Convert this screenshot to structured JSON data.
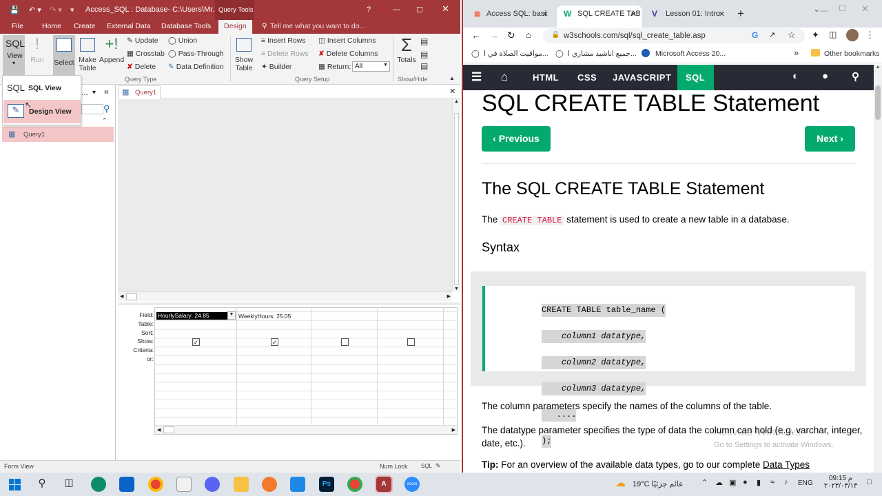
{
  "access": {
    "title": "Access_SQL : Database- C:\\Users\\Mr.Ya...",
    "query_tools": "Query Tools",
    "window_help": "?",
    "tabs": [
      "File",
      "Home",
      "Create",
      "External Data",
      "Database Tools",
      "Design"
    ],
    "tell_me": "Tell me what you want to do...",
    "ribbon": {
      "view": "View",
      "view_sql_glyph": "SQL",
      "run": "Run",
      "select": "Select",
      "make_table": "Make\nTable",
      "append": "Append",
      "update": "Update",
      "crosstab": "Crosstab",
      "delete": "Delete",
      "union": "Union",
      "pass_through": "Pass-Through",
      "data_definition": "Data Definition",
      "show_table": "Show\nTable",
      "insert_rows": "Insert Rows",
      "delete_rows": "Delete Rows",
      "builder": "Builder",
      "insert_columns": "Insert Columns",
      "delete_columns": "Delete Columns",
      "return_label": "Return:",
      "return_value": "All",
      "totals": "Totals",
      "group_query_type": "Query Type",
      "group_query_setup": "Query Setup",
      "group_show_hide": "Show/Hide"
    },
    "view_menu": {
      "sql_view_glyph": "SQL",
      "sql_view": "SQL View",
      "design_view": "Design View"
    },
    "nav": {
      "ellipsis": "...",
      "item": "Query1"
    },
    "query_tab": "Query1",
    "grid": {
      "row_labels": [
        "Field:",
        "Table:",
        "Sort:",
        "Show:",
        "Criteria:",
        "or:"
      ],
      "fields": [
        "HourlySalary: 24.85",
        "WeeklyHours: 25.05",
        "",
        ""
      ],
      "show": [
        true,
        true,
        false,
        false
      ]
    },
    "status_left": "Form View",
    "status_right": "Num Lock",
    "status_sql": "SQL"
  },
  "chrome": {
    "tabs": [
      "Access SQL: basi",
      "SQL CREATE TAB",
      "Lesson 01: Intro"
    ],
    "url": "w3schools.com/sql/sql_create_table.asp",
    "bookmarks": [
      "مواقيت الصلاة في ا...",
      "جميع اناشيد مشاري ا...",
      "Microsoft Access 20...",
      "Other bookmarks"
    ],
    "more": "»",
    "nav": [
      "HTML",
      "CSS",
      "JAVASCRIPT",
      "SQL"
    ],
    "page": {
      "h1": "SQL CREATE TABLE Statement",
      "prev": "Previous",
      "next": "Next",
      "h2": "The SQL CREATE TABLE Statement",
      "intro_a": "The ",
      "intro_code": "CREATE TABLE",
      "intro_b": " statement is used to create a new table in a database.",
      "syntax": "Syntax",
      "code": [
        "CREATE TABLE table_name (",
        "    column1 datatype,",
        "    column2 datatype,",
        "    column3 datatype,",
        "   ....",
        ");"
      ],
      "p1": "The column parameters specify the names of the columns of the table.",
      "p2": "The datatype parameter specifies the type of data the column can hold (e.g. varchar, integer, date, etc.).",
      "tip_label": "Tip:",
      "tip_text": " For an overview of the available data types, go to our complete ",
      "tip_link": "Data Types",
      "watermark1": "Activate Windows",
      "watermark2": "Go to Settings to activate Windows."
    }
  },
  "taskbar": {
    "weather": "19°C عائم جزئيًا",
    "lang": "ENG",
    "time": "09:15 م",
    "date": "٢٠٢٣/٠٣/١٣",
    "zoom": "zoom"
  },
  "colors": {
    "access_red": "#a4373a",
    "w3_green": "#04aa6d",
    "w3_dark": "#282a35"
  }
}
